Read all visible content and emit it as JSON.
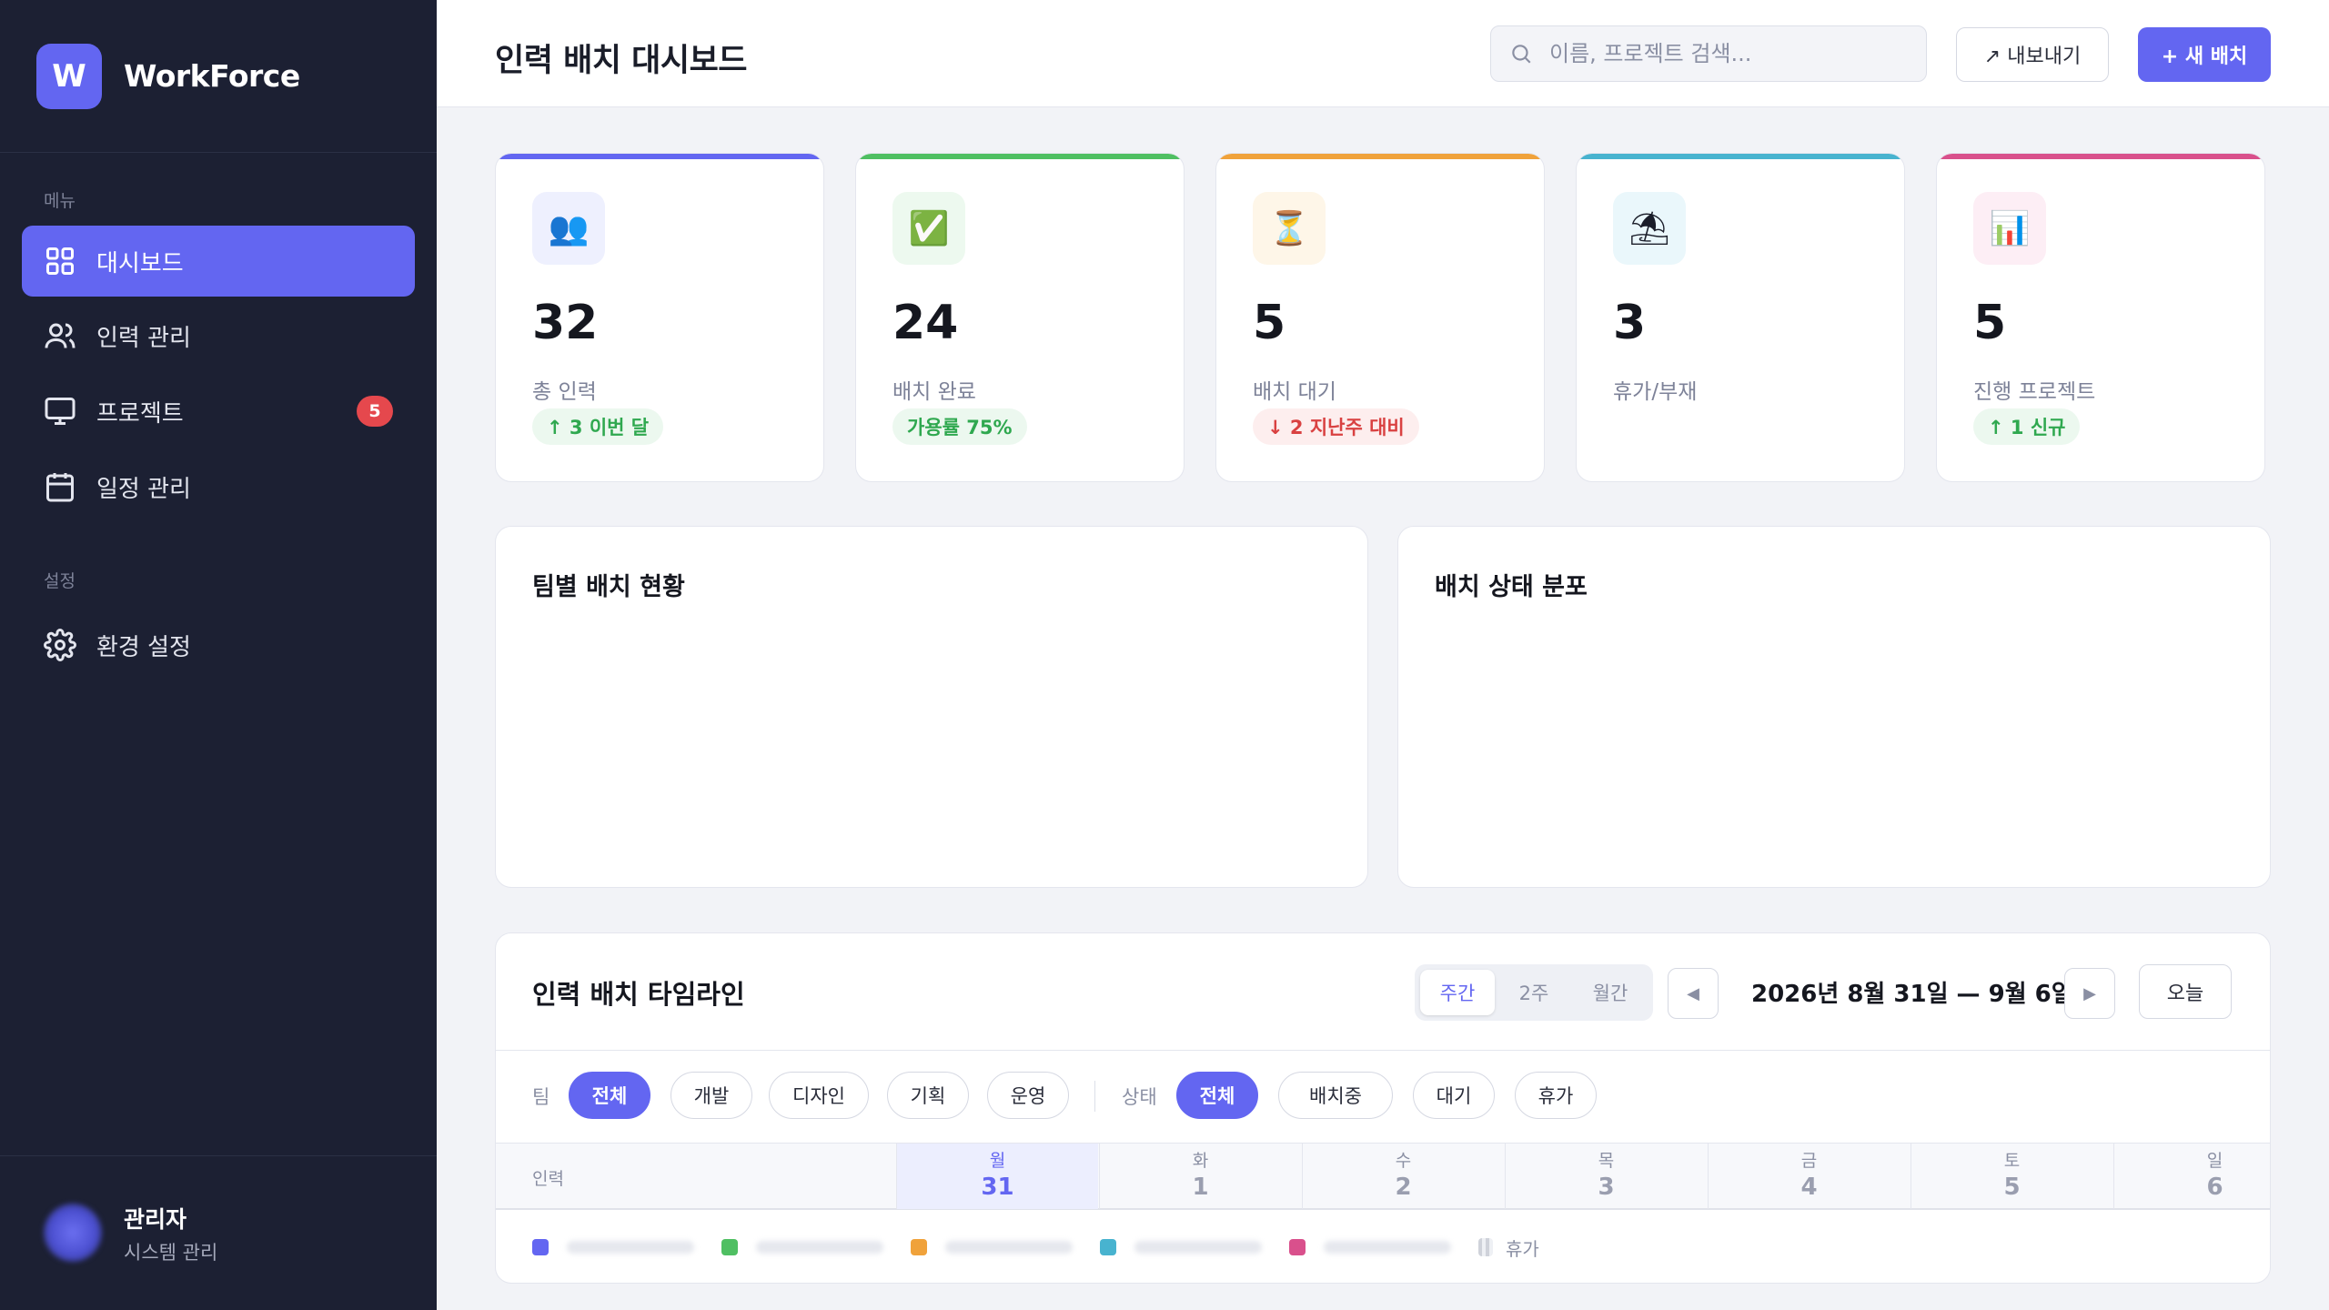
{
  "app": {
    "logo_letter": "W",
    "name": "WorkForce"
  },
  "sidebar": {
    "menu_label": "메뉴",
    "settings_label": "설정",
    "items": [
      {
        "label": "대시보드",
        "icon": "grid-icon",
        "active": true
      },
      {
        "label": "인력 관리",
        "icon": "users-icon"
      },
      {
        "label": "프로젝트",
        "icon": "monitor-icon",
        "badge": "5"
      },
      {
        "label": "일정 관리",
        "icon": "calendar-icon"
      }
    ],
    "settings_items": [
      {
        "label": "환경 설정",
        "icon": "gear-icon"
      }
    ],
    "user": {
      "name": "관리자",
      "role": "시스템 관리"
    }
  },
  "header": {
    "title": "인력 배치 대시보드",
    "search_placeholder": "이름, 프로젝트 검색...",
    "export_label": "↗ 내보내기",
    "new_label": "+ 새 배치"
  },
  "stats": [
    {
      "icon": "👥",
      "value": "32",
      "label": "총 인력",
      "delta": "↑ 3 이번 달",
      "delta_type": "up",
      "color": "#6366f1",
      "icon_bg": "#eef0fe"
    },
    {
      "icon": "✅",
      "value": "24",
      "label": "배치 완료",
      "delta": "가용률 75%",
      "delta_type": "up",
      "color": "#4fbf62",
      "icon_bg": "#edf9ef"
    },
    {
      "icon": "⏳",
      "value": "5",
      "label": "배치 대기",
      "delta": "↓ 2 지난주 대비",
      "delta_type": "down",
      "color": "#f0a23b",
      "icon_bg": "#fef6e8"
    },
    {
      "icon": "⛱",
      "value": "3",
      "label": "휴가/부재",
      "delta": "",
      "delta_type": "none",
      "color": "#48b3cf",
      "icon_bg": "#eaf7fb"
    },
    {
      "icon": "📊",
      "value": "5",
      "label": "진행 프로젝트",
      "delta": "↑ 1 신규",
      "delta_type": "up",
      "color": "#d9508c",
      "icon_bg": "#fdeef5"
    }
  ],
  "panels": {
    "team_title": "팀별 배치 현황",
    "status_title": "배치 상태 분포"
  },
  "timeline": {
    "title": "인력 배치 타임라인",
    "views": [
      "주간",
      "2주",
      "월간"
    ],
    "active_view": 0,
    "range": "2026년 8월 31일 — 9월 6일",
    "prev_icon": "◀",
    "next_icon": "▶",
    "today_label": "오늘",
    "team_filter_label": "팀",
    "team_filters": [
      "전체",
      "개발",
      "디자인",
      "기획",
      "운영"
    ],
    "status_filter_label": "상태",
    "status_filters": [
      "전체",
      "배치중",
      "대기",
      "휴가"
    ],
    "name_column": "인력",
    "days": [
      {
        "name": "월",
        "num": "31",
        "today": true
      },
      {
        "name": "화",
        "num": "1"
      },
      {
        "name": "수",
        "num": "2"
      },
      {
        "name": "목",
        "num": "3"
      },
      {
        "name": "금",
        "num": "4"
      },
      {
        "name": "토",
        "num": "5"
      },
      {
        "name": "일",
        "num": "6"
      }
    ],
    "legend_colors": [
      "#6366f1",
      "#4fbf62",
      "#f0a23b",
      "#48b3cf",
      "#d9508c"
    ],
    "legend_vacation": "휴가"
  }
}
